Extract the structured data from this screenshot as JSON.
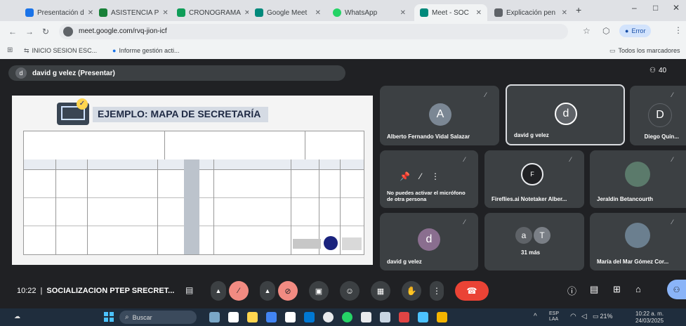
{
  "tabs": [
    {
      "label": "Presentación d",
      "color": "#1a73e8"
    },
    {
      "label": "ASISTENCIA P",
      "color": "#188038"
    },
    {
      "label": "CRONOGRAMA",
      "color": "#0f9d58"
    },
    {
      "label": "Google Meet",
      "color": "#00897b"
    },
    {
      "label": "WhatsApp",
      "color": "#25d366"
    },
    {
      "label": "Meet - SOC",
      "color": "#00897b"
    },
    {
      "label": "Explicación pen",
      "color": "#5f6368"
    }
  ],
  "address": {
    "url": "meet.google.com/rvq-jion-icf",
    "error_label": "Error"
  },
  "bookmarks": [
    {
      "label": "INICIO SESION ESC..."
    },
    {
      "label": "Informe gestión acti..."
    }
  ],
  "bookmarks_all": "Todos los marcadores",
  "meet": {
    "presenter_label": "david g velez (Presentar)",
    "participant_count": "40",
    "slide": {
      "title": "EJEMPLO: MAPA DE SECRETARÍA"
    },
    "tiles": [
      {
        "name": "Alberto Fernando Vidal Salazar",
        "initial": "A",
        "avatar_color": "#7b8794"
      },
      {
        "name": "david g velez",
        "initial": "d",
        "avatar_color": "#5f6368"
      },
      {
        "name": "Diego Quin...",
        "initial": "D",
        "avatar_color": "#3c4043"
      },
      {
        "name": "No puedes activar el micrófono de otra persona",
        "initial": "",
        "avatar_color": ""
      },
      {
        "name": "Fireflies.ai Notetaker Alber...",
        "initial": "F",
        "avatar_color": "#202124"
      },
      {
        "name": "Jeraldin Betancourth",
        "initial": "",
        "avatar_color": "#5b7a6b"
      },
      {
        "name": "david g velez",
        "initial": "d",
        "avatar_color": "#8a6e8f"
      },
      {
        "name": "31 más",
        "initial": "a",
        "avatar_color": "#5f6368",
        "extra_initial": "T"
      },
      {
        "name": "María del Mar Gómez Cor...",
        "initial": "",
        "avatar_color": "#6b7f8f"
      }
    ],
    "meeting_time": "10:22",
    "meeting_name": "SOCIALIZACION PTEP SRECRET..."
  },
  "taskbar": {
    "search_placeholder": "Buscar",
    "lang": "ESP\nLAA",
    "time": "10:22 a. m.",
    "date": "24/03/2025",
    "battery": "21%"
  }
}
